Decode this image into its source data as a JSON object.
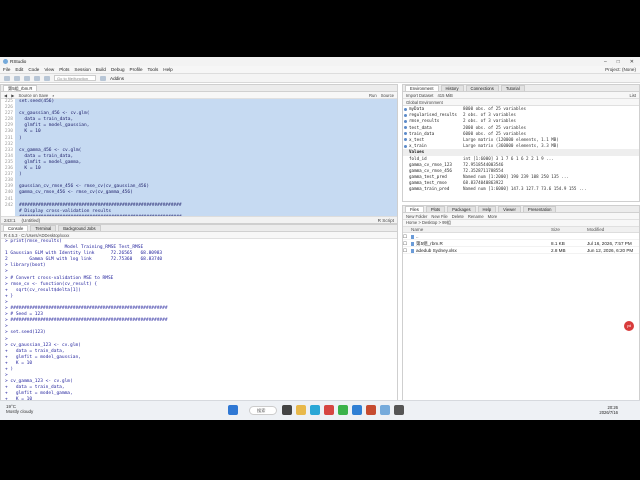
{
  "window": {
    "title": "RStudio",
    "controls": [
      "–",
      "□",
      "✕"
    ]
  },
  "menu": {
    "items": [
      "File",
      "Edit",
      "Code",
      "View",
      "Plots",
      "Session",
      "Build",
      "Debug",
      "Profile",
      "Tools",
      "Help"
    ],
    "project": "Project: (None)"
  },
  "toolbar": {
    "goto_placeholder": "Go to file/function",
    "addins": "Addins"
  },
  "editor": {
    "tab": "第5组_rbm.R",
    "source_on_save": "Source on Save",
    "run": "Run",
    "source": "Source",
    "line_numbers": [
      "225",
      "226",
      "227",
      "228",
      "229",
      "230",
      "231",
      "232",
      "233",
      "234",
      "235",
      "236",
      "237",
      "238",
      "239",
      "240",
      "241",
      "242"
    ],
    "lines": [
      "set.seed(456)",
      "",
      "cv_gaussian_456 <- cv.glm(",
      "  data = train_data,",
      "  glmfit = model_gaussian,",
      "  K = 10",
      ")",
      "",
      "cv_gamma_456 <- cv.glm(",
      "  data = train_data,",
      "  glmfit = model_gamma,",
      "  K = 10",
      ")",
      "",
      "gaussian_cv_rmse_456 <- rmse_cv(cv_gaussian_456)",
      "gamma_cv_rmse_456 <- rmse_cv(cv_gamma_456)",
      "",
      "############################################################",
      "# Display cross-validation results",
      "############################################################"
    ],
    "status_pos": "243:1",
    "status_context": "(Untitled)",
    "status_lang": "R Script"
  },
  "console": {
    "tabs": [
      "Console",
      "Terminal",
      "Background Jobs"
    ],
    "path": "R 4.5.3 · C:/Users/ADDesktop/xxxx",
    "lines": [
      "> print(rmse_results)",
      "                      Model Training_RMSE Test_RMSE",
      "1 Gaussian GLM with Identity link      72.26565   68.80983",
      "2        Gamma GLM with log link       72.75360   68.83740",
      "> library(boot)",
      ">",
      "> # Convert cross-validation MSE to RMSE",
      "> rmse_cv <- function(cv_result) {",
      "+   sqrt(cv_result$delta[1])",
      "+ }",
      ">",
      "> ##########################################################",
      "> # Seed = 123",
      "> ##########################################################",
      ">",
      "> set.seed(123)",
      ">",
      "> cv_gaussian_123 <- cv.glm(",
      "+   data = train_data,",
      "+   glmfit = model_gaussian,",
      "+   K = 10",
      "+ )",
      ">",
      "> cv_gamma_123 <- cv.glm(",
      "+   data = train_data,",
      "+   glmfit = model_gamma,",
      "+   K = 10",
      "+ )"
    ]
  },
  "environment": {
    "tabs": [
      "Environment",
      "History",
      "Connections",
      "Tutorial"
    ],
    "import": "Import Dataset",
    "memory": "415 MiB",
    "scope": "Global Environment",
    "view": "List",
    "data_rows": [
      {
        "name": "myData",
        "value": "8000 obs. of 25 variables"
      },
      {
        "name": "regularised_results",
        "value": "2 obs. of 3 variables"
      },
      {
        "name": "rmse_results",
        "value": "2 obs. of 3 variables"
      },
      {
        "name": "test_data",
        "value": "2000 obs. of 25 variables"
      },
      {
        "name": "train_data",
        "value": "6000 obs. of 25 variables"
      },
      {
        "name": "x_test",
        "value": "Large matrix (120000 elements, 1.1 MB)"
      },
      {
        "name": "x_train",
        "value": "Large matrix (360000 elements, 3.3 MB)"
      }
    ],
    "values_header": "Values",
    "value_rows": [
      {
        "name": "fold_id",
        "value": "int [1:6000] 3 1 7 6 1 6 2 2 1 9 ..."
      },
      {
        "name": "gamma_cv_rmse_123",
        "value": "72.9518544003546"
      },
      {
        "name": "gamma_cv_rmse_456",
        "value": "72.3528711788554"
      },
      {
        "name": "gamma_test_pred",
        "value": "Named num [1:2000] 190 239 108 250 135 ..."
      },
      {
        "name": "gamma_test_rmse",
        "value": "68.8374040863922"
      },
      {
        "name": "gamma_train_pred",
        "value": "Named num [1:6000] 147.3 127.7 73.6 154.9 155 ..."
      }
    ]
  },
  "files": {
    "tabs": [
      "Files",
      "Plots",
      "Packages",
      "Help",
      "Viewer",
      "Presentation"
    ],
    "actions": [
      "New Folder",
      "New File",
      "Delete",
      "Rename",
      "More"
    ],
    "breadcrumb": "Home > Desktop > 99组",
    "columns": [
      "Name",
      "Size",
      "Modified"
    ],
    "rows": [
      {
        "name": "..",
        "size": "",
        "modified": ""
      },
      {
        "name": "第5组_rbm.R",
        "size": "8.1 KB",
        "modified": "Jul 16, 2026, 7:57 PM"
      },
      {
        "name": "adedub Sydney.xlsx",
        "size": "2.8 MB",
        "modified": "Jun 12, 2026, 6:20 PM"
      }
    ]
  },
  "taskbar": {
    "weather_temp": "19°C",
    "weather_desc": "Mostly cloudy",
    "search_label": "搜索",
    "time": "20:26",
    "date": "2026/7/16"
  },
  "floating_badge": "yd"
}
